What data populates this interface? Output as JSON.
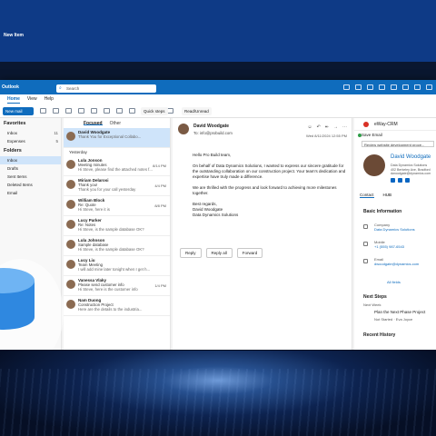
{
  "top": {
    "new_item": "New Item"
  },
  "window": {
    "app_title": "Outlook",
    "search_placeholder": "Search"
  },
  "menu": [
    "Home",
    "View",
    "Help"
  ],
  "ribbon": {
    "new_mail": "New mail",
    "quick_steps": "Quick steps",
    "read_unread": "Read/Unread"
  },
  "folders": {
    "favorites_header": "Favorites",
    "favorites": [
      {
        "name": "Inbox",
        "count": "11"
      },
      {
        "name": "Expenses",
        "count": "5"
      }
    ],
    "folders_header": "Folders",
    "items": [
      {
        "name": "Inbox",
        "count": ""
      },
      {
        "name": "Drafts",
        "count": ""
      },
      {
        "name": "Sent Items",
        "count": ""
      },
      {
        "name": "Deleted Items",
        "count": ""
      },
      {
        "name": "Email",
        "count": ""
      }
    ]
  },
  "list": {
    "tab_focused": "Focused",
    "tab_other": "Other",
    "group_yesterday": "Yesterday",
    "messages": [
      {
        "from": "David Woodgate",
        "subject": "",
        "preview": "Thank You for Exceptional Collabo...",
        "time": ""
      },
      {
        "from": "Lula Jonson",
        "subject": "Meeting minutes",
        "preview": "Hi Steve, please find the attached notes f...",
        "time": "8/14 PM"
      },
      {
        "from": "Miriam Delarosi",
        "subject": "Thank you!",
        "preview": "Thank you for your call yesterday",
        "time": "4/4 PM"
      },
      {
        "from": "William Block",
        "subject": "Re: Quote",
        "preview": "Hi Steve, here it is",
        "time": "8/8 PM"
      },
      {
        "from": "Lucy Parker",
        "subject": "Re: Notes",
        "preview": "Hi Steve, is the sample database OK?",
        "time": ""
      },
      {
        "from": "Lula Johnson",
        "subject": "Sample database",
        "preview": "Hi Steve, is the sample database OK?",
        "time": ""
      },
      {
        "from": "Lucy Liu",
        "subject": "Team Meeting",
        "preview": "I will add mine later tonight when I get h...",
        "time": ""
      },
      {
        "from": "Vanessa Vlaky",
        "subject": "Please send customer info",
        "preview": "Hi Steve, here is the customer info",
        "time": "1/4 PM"
      },
      {
        "from": "Nam Duong",
        "subject": "Construction Project",
        "preview": "Here are the details to the industria...",
        "time": ""
      }
    ]
  },
  "reading": {
    "from": "David Woodgate",
    "to": "To: info@probuild.com",
    "date": "Wed 8/11/2024 12:55 PM",
    "greeting": "Hello Pro Build team,",
    "para1": "On behalf of Data Dynamics Solutions, I wanted to express our sincere gratitude for the outstanding collaboration on our construction project. Your team's dedication and expertise have truly made a difference.",
    "para2": "We are thrilled with the progress and look forward to achieving more milestones together.",
    "sign": [
      "Best regards,",
      "David Woodgate",
      "Data Dynamics Solutions"
    ],
    "reply": "Reply",
    "reply_all": "Reply all",
    "forward": "Forward"
  },
  "crm": {
    "title": "eWay-CRM",
    "save_email": "Save Email",
    "review": "Review website development proce...",
    "name": "David Woodgate",
    "address": [
      "Data Dynamics Solutions",
      "402 Berkeley Ave, Bradford",
      "dwoodgate@dynamics.com"
    ],
    "tab_contact": "Contact",
    "tab_hub": "HUB",
    "basic_info": "Basic Information",
    "company_label": "Company",
    "company_value": "Data Dynamics Solutions",
    "mobile_label": "Mobile",
    "mobile_value": "+1 (555) 987-6543",
    "email_label": "Email",
    "email_value": "dwoodgate@dynamics.com",
    "all_fields": "All fields",
    "next_steps": "Next Steps",
    "next_week": "Next Week",
    "task_title": "Plan the Next Phase Project",
    "task_meta": "Not Started · Eva Joyce",
    "recent_history": "Recent History"
  }
}
